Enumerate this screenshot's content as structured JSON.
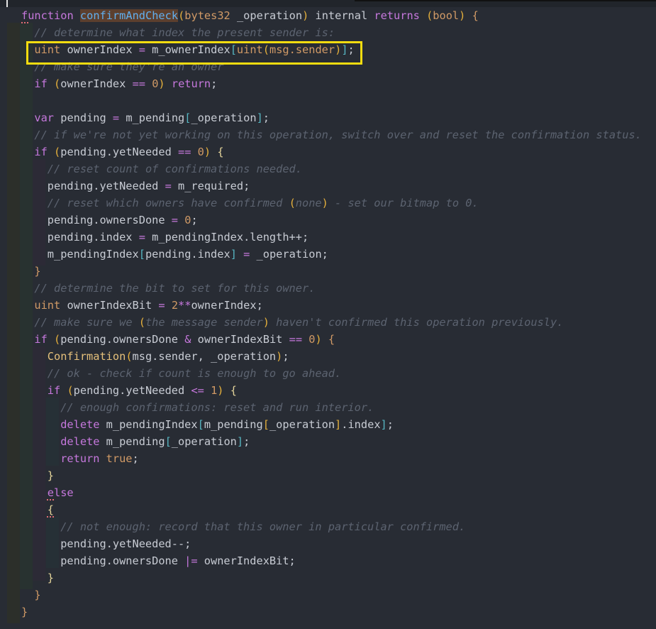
{
  "editor": {
    "lines": [
      {
        "indent": 0,
        "tokens": [
          [
            "kw",
            "function"
          ],
          [
            "tx",
            " "
          ],
          [
            "fn",
            "confirmAndCheck"
          ],
          [
            "pa",
            "("
          ],
          [
            "ty",
            "bytes32"
          ],
          [
            "tx",
            " _operation"
          ],
          [
            "pa",
            ")"
          ],
          [
            "tx",
            " internal "
          ],
          [
            "kw",
            "returns"
          ],
          [
            "tx",
            " "
          ],
          [
            "pa",
            "("
          ],
          [
            "ty",
            "bool"
          ],
          [
            "pa",
            ")"
          ],
          [
            "tx",
            " "
          ],
          [
            "bc",
            "{"
          ]
        ]
      },
      {
        "indent": 1,
        "tokens": [
          [
            "cm",
            "// determine what index the present sender is:"
          ]
        ]
      },
      {
        "indent": 1,
        "tokens": [
          [
            "ty",
            "uint"
          ],
          [
            "tx",
            " ownerIndex "
          ],
          [
            "op",
            "="
          ],
          [
            "tx",
            " m_ownerIndex"
          ],
          [
            "br",
            "["
          ],
          [
            "ty",
            "uint"
          ],
          [
            "pa",
            "("
          ],
          [
            "ty",
            "msg.sender"
          ],
          [
            "pa",
            ")"
          ],
          [
            "br",
            "]"
          ],
          [
            "tx",
            ";"
          ]
        ]
      },
      {
        "indent": 1,
        "tokens": [
          [
            "cm",
            "// make sure they're an owner"
          ]
        ]
      },
      {
        "indent": 1,
        "tokens": [
          [
            "kw",
            "if"
          ],
          [
            "tx",
            " "
          ],
          [
            "pa",
            "("
          ],
          [
            "tx",
            "ownerIndex "
          ],
          [
            "op",
            "=="
          ],
          [
            "tx",
            " "
          ],
          [
            "num",
            "0"
          ],
          [
            "pa",
            ")"
          ],
          [
            "tx",
            " "
          ],
          [
            "kw",
            "return"
          ],
          [
            "tx",
            ";"
          ]
        ]
      },
      {
        "indent": 0,
        "tokens": []
      },
      {
        "indent": 1,
        "tokens": [
          [
            "kw",
            "var"
          ],
          [
            "tx",
            " pending "
          ],
          [
            "op",
            "="
          ],
          [
            "tx",
            " m_pending"
          ],
          [
            "br",
            "["
          ],
          [
            "tx",
            "_operation"
          ],
          [
            "br",
            "]"
          ],
          [
            "tx",
            ";"
          ]
        ]
      },
      {
        "indent": 1,
        "tokens": [
          [
            "cm",
            "// if we're not yet working on this operation, switch over and reset the confirmation status."
          ]
        ]
      },
      {
        "indent": 1,
        "tokens": [
          [
            "kw",
            "if"
          ],
          [
            "tx",
            " "
          ],
          [
            "pa",
            "("
          ],
          [
            "tx",
            "pending.yetNeeded "
          ],
          [
            "op",
            "=="
          ],
          [
            "tx",
            " "
          ],
          [
            "num",
            "0"
          ],
          [
            "pa",
            ")"
          ],
          [
            "tx",
            " "
          ],
          [
            "by",
            "{"
          ]
        ]
      },
      {
        "indent": 2,
        "tokens": [
          [
            "cm",
            "// reset count of confirmations needed."
          ]
        ]
      },
      {
        "indent": 2,
        "tokens": [
          [
            "tx",
            "pending.yetNeeded "
          ],
          [
            "op",
            "="
          ],
          [
            "tx",
            " m_required;"
          ]
        ]
      },
      {
        "indent": 2,
        "tokens": [
          [
            "cm",
            "// reset which owners have confirmed "
          ],
          [
            "pa",
            "("
          ],
          [
            "cm",
            "none"
          ],
          [
            "pa",
            ")"
          ],
          [
            "cm",
            " - set our bitmap to 0."
          ]
        ]
      },
      {
        "indent": 2,
        "tokens": [
          [
            "tx",
            "pending.ownersDone "
          ],
          [
            "op",
            "="
          ],
          [
            "tx",
            " "
          ],
          [
            "num",
            "0"
          ],
          [
            "tx",
            ";"
          ]
        ]
      },
      {
        "indent": 2,
        "tokens": [
          [
            "tx",
            "pending.index "
          ],
          [
            "op",
            "="
          ],
          [
            "tx",
            " m_pendingIndex.length++;"
          ]
        ]
      },
      {
        "indent": 2,
        "tokens": [
          [
            "tx",
            "m_pendingIndex"
          ],
          [
            "br",
            "["
          ],
          [
            "tx",
            "pending.index"
          ],
          [
            "br",
            "]"
          ],
          [
            "tx",
            " "
          ],
          [
            "op",
            "="
          ],
          [
            "tx",
            " _operation;"
          ]
        ]
      },
      {
        "indent": 1,
        "tokens": [
          [
            "bc",
            "}"
          ]
        ]
      },
      {
        "indent": 1,
        "tokens": [
          [
            "cm",
            "// determine the bit to set for this owner."
          ]
        ]
      },
      {
        "indent": 1,
        "tokens": [
          [
            "ty",
            "uint"
          ],
          [
            "tx",
            " ownerIndexBit "
          ],
          [
            "op",
            "="
          ],
          [
            "tx",
            " "
          ],
          [
            "num",
            "2"
          ],
          [
            "op",
            "**"
          ],
          [
            "tx",
            "ownerIndex;"
          ]
        ]
      },
      {
        "indent": 1,
        "tokens": [
          [
            "cm",
            "// make sure we "
          ],
          [
            "pa",
            "("
          ],
          [
            "cm",
            "the message sender"
          ],
          [
            "pa",
            ")"
          ],
          [
            "cm",
            " haven't confirmed this operation previously."
          ]
        ]
      },
      {
        "indent": 1,
        "tokens": [
          [
            "kw",
            "if"
          ],
          [
            "tx",
            " "
          ],
          [
            "pa",
            "("
          ],
          [
            "tx",
            "pending.ownersDone "
          ],
          [
            "op",
            "&"
          ],
          [
            "tx",
            " ownerIndexBit "
          ],
          [
            "op",
            "=="
          ],
          [
            "tx",
            " "
          ],
          [
            "num",
            "0"
          ],
          [
            "pa",
            ")"
          ],
          [
            "tx",
            " "
          ],
          [
            "bc",
            "{"
          ]
        ]
      },
      {
        "indent": 2,
        "tokens": [
          [
            "cl",
            "Confirmation"
          ],
          [
            "pa",
            "("
          ],
          [
            "tx",
            "msg.sender, _operation"
          ],
          [
            "pa",
            ")"
          ],
          [
            "tx",
            ";"
          ]
        ]
      },
      {
        "indent": 2,
        "tokens": [
          [
            "cm",
            "// ok - check if count is enough to go ahead."
          ]
        ]
      },
      {
        "indent": 2,
        "tokens": [
          [
            "kw",
            "if"
          ],
          [
            "tx",
            " "
          ],
          [
            "pa",
            "("
          ],
          [
            "tx",
            "pending.yetNeeded "
          ],
          [
            "op",
            "<="
          ],
          [
            "tx",
            " "
          ],
          [
            "num",
            "1"
          ],
          [
            "pa",
            ")"
          ],
          [
            "tx",
            " "
          ],
          [
            "by",
            "{"
          ]
        ]
      },
      {
        "indent": 3,
        "tokens": [
          [
            "cm",
            "// enough confirmations: reset and run interior."
          ]
        ]
      },
      {
        "indent": 3,
        "tokens": [
          [
            "kw",
            "delete"
          ],
          [
            "tx",
            " m_pendingIndex"
          ],
          [
            "br",
            "["
          ],
          [
            "tx",
            "m_pending"
          ],
          [
            "pa",
            "["
          ],
          [
            "tx",
            "_operation"
          ],
          [
            "pa",
            "]"
          ],
          [
            "tx",
            ".index"
          ],
          [
            "br",
            "]"
          ],
          [
            "tx",
            ";"
          ]
        ]
      },
      {
        "indent": 3,
        "tokens": [
          [
            "kw",
            "delete"
          ],
          [
            "tx",
            " m_pending"
          ],
          [
            "br",
            "["
          ],
          [
            "tx",
            "_operation"
          ],
          [
            "br",
            "]"
          ],
          [
            "tx",
            ";"
          ]
        ]
      },
      {
        "indent": 3,
        "tokens": [
          [
            "kw",
            "return"
          ],
          [
            "tx",
            " "
          ],
          [
            "num",
            "true"
          ],
          [
            "tx",
            ";"
          ]
        ]
      },
      {
        "indent": 2,
        "tokens": [
          [
            "by",
            "}"
          ]
        ]
      },
      {
        "indent": 2,
        "tokens": [
          [
            "kw",
            "else"
          ]
        ]
      },
      {
        "indent": 2,
        "tokens": [
          [
            "by",
            "{"
          ]
        ]
      },
      {
        "indent": 3,
        "tokens": [
          [
            "cm",
            "// not enough: record that this owner in particular confirmed."
          ]
        ]
      },
      {
        "indent": 3,
        "tokens": [
          [
            "tx",
            "pending.yetNeeded--;"
          ]
        ]
      },
      {
        "indent": 3,
        "tokens": [
          [
            "tx",
            "pending.ownersDone "
          ],
          [
            "op",
            "|="
          ],
          [
            "tx",
            " ownerIndexBit;"
          ]
        ]
      },
      {
        "indent": 2,
        "tokens": [
          [
            "by",
            "}"
          ]
        ]
      },
      {
        "indent": 1,
        "tokens": [
          [
            "bc",
            "}"
          ]
        ]
      },
      {
        "indent": 0,
        "tokens": [
          [
            "bc",
            "}"
          ]
        ]
      }
    ]
  }
}
